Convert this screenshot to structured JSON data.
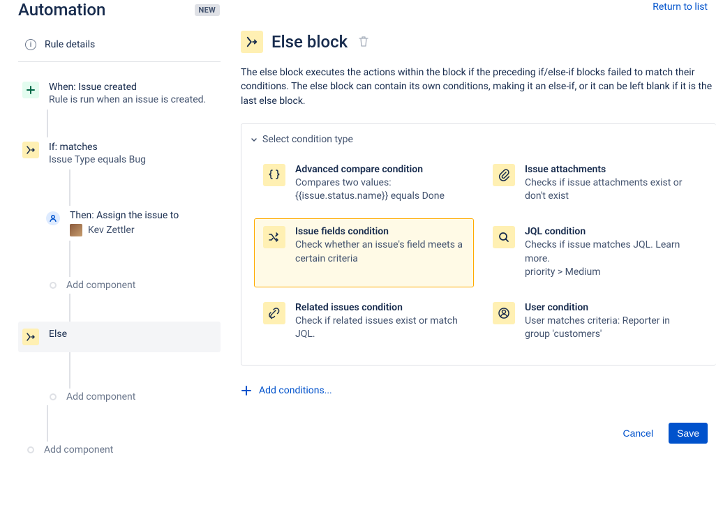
{
  "header": {
    "title": "Automation",
    "badge": "NEW",
    "return_link": "Return to list"
  },
  "sidebar": {
    "rule_details": "Rule details",
    "trigger": {
      "title": "When: Issue created",
      "subtitle": "Rule is run when an issue is created."
    },
    "if_block": {
      "title": "If: matches",
      "subtitle": "Issue Type equals Bug"
    },
    "then_block": {
      "title": "Then: Assign the issue to",
      "assignee": "Kev Zettler"
    },
    "else_block": {
      "title": "Else"
    },
    "add_component": "Add component"
  },
  "main": {
    "title": "Else block",
    "description": "The else block executes the actions within the block if the preceding if/else-if blocks failed to match their conditions. The else block can contain its own conditions, making it an else-if, or it can be left blank if it is the last else block.",
    "panel_title": "Select condition type",
    "conditions": [
      {
        "title": "Advanced compare condition",
        "desc": "Compares two values: {{issue.status.name}} equals Done"
      },
      {
        "title": "Issue attachments",
        "desc": "Checks if issue attachments exist or don't exist"
      },
      {
        "title": "Issue fields condition",
        "desc": "Check whether an issue's field meets a certain criteria"
      },
      {
        "title": "JQL condition",
        "desc": "Checks if issue matches JQL. Learn more.\npriority > Medium"
      },
      {
        "title": "Related issues condition",
        "desc": "Check if related issues exist or match JQL."
      },
      {
        "title": "User condition",
        "desc": "User matches criteria: Reporter in group 'customers'"
      }
    ],
    "add_conditions": "Add conditions...",
    "cancel": "Cancel",
    "save": "Save"
  }
}
